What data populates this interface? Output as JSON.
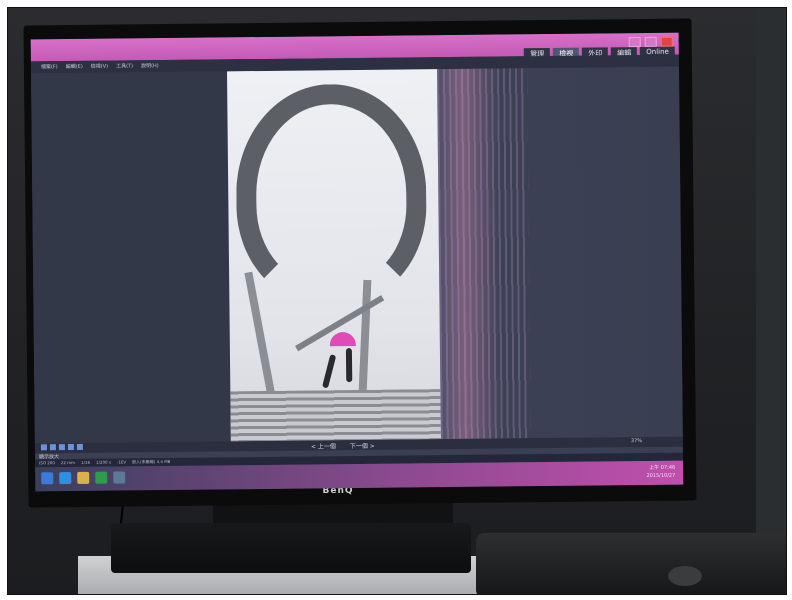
{
  "tv": {
    "brand": "BenQ"
  },
  "app": {
    "window_title": "",
    "mode_tabs": [
      {
        "label": "管理",
        "active": false
      },
      {
        "label": "檢視",
        "active": true
      },
      {
        "label": "外印",
        "active": false
      },
      {
        "label": "編輯",
        "active": false
      },
      {
        "label": "Online",
        "active": false
      }
    ],
    "menu": [
      {
        "label": "檔案(F)"
      },
      {
        "label": "編輯(E)"
      },
      {
        "label": "檢視(V)"
      },
      {
        "label": "工具(T)"
      },
      {
        "label": "說明(H)"
      }
    ],
    "toolbar": {
      "prev_label": "< 上一個",
      "next_label": "下一個 >",
      "zoom": "37%"
    },
    "status": {
      "left_label": "顯示放大",
      "info": [
        "ISO 200",
        "22 mm",
        "1/16",
        "1/200 s",
        "-1EV",
        "嵌入(未壓縮) 4.4 MB"
      ]
    },
    "clock": {
      "time": "上午 07:46",
      "date": "2015/10/27"
    }
  },
  "colors": {
    "titlebar": "#d86fc9",
    "accent": "#e04bb8",
    "screen_bg": "#3a3f52"
  }
}
